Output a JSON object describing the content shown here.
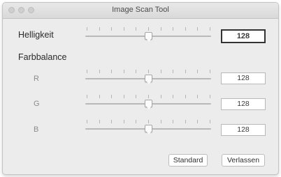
{
  "window": {
    "title": "Image Scan Tool"
  },
  "brightness": {
    "label": "Helligkeit",
    "value": "128",
    "level": 0.5
  },
  "color_balance": {
    "label": "Farbbalance",
    "channels": [
      {
        "name": "R",
        "value": "128",
        "level": 0.5
      },
      {
        "name": "G",
        "value": "128",
        "level": 0.5
      },
      {
        "name": "B",
        "value": "128",
        "level": 0.5
      }
    ]
  },
  "buttons": {
    "standard": "Standard",
    "quit": "Verlassen"
  }
}
